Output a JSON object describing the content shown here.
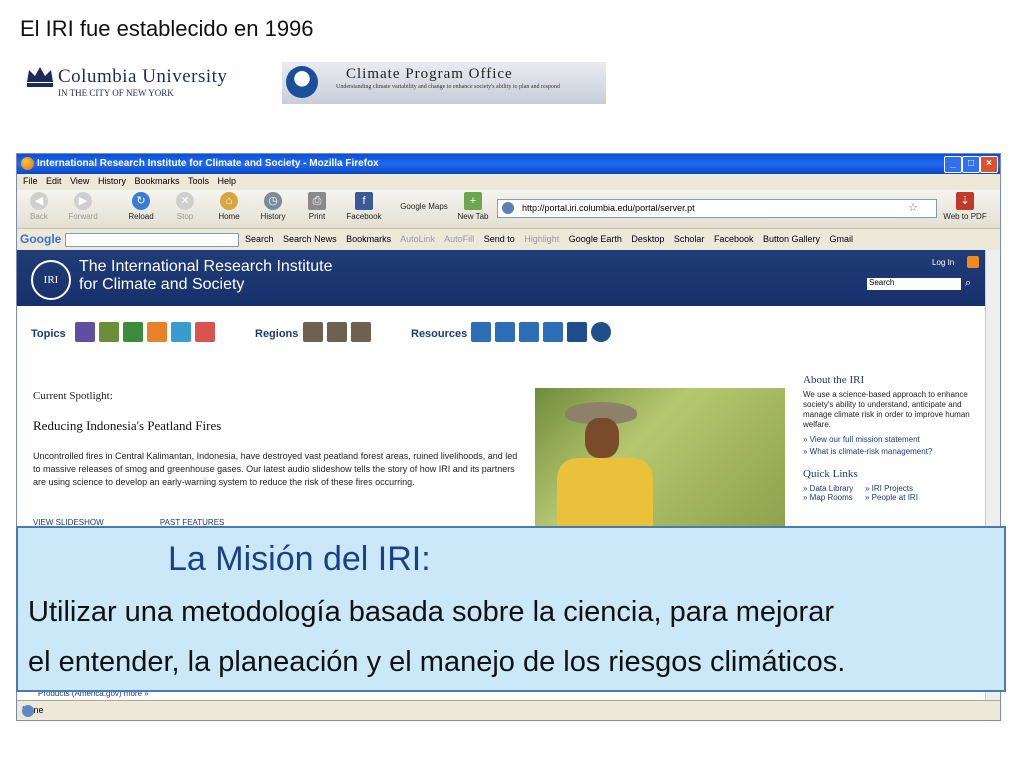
{
  "slide": {
    "title": "El IRI fue establecido en 1996",
    "columbia": {
      "name": "Columbia University",
      "sub": "IN THE CITY OF NEW YORK"
    },
    "cpo": {
      "title": "Climate Program Office",
      "sub": "Understanding climate variability and change to enhance society's ability to plan and respond"
    }
  },
  "browser": {
    "window_title": "International Research Institute for Climate and Society - Mozilla Firefox",
    "menu": [
      "File",
      "Edit",
      "View",
      "History",
      "Bookmarks",
      "Tools",
      "Help"
    ],
    "nav": {
      "back": "Back",
      "forward": "Forward",
      "reload": "Reload",
      "stop": "Stop",
      "home": "Home",
      "history": "History",
      "print": "Print",
      "facebook": "Facebook",
      "google_maps": "Google Maps",
      "new_tab": "New Tab",
      "web_to_pdf": "Web to PDF"
    },
    "url": "http://portal.iri.columbia.edu/portal/server.pt",
    "google_logo": "Google",
    "google_items": [
      "Search",
      "Search News",
      "Bookmarks",
      "AutoLink",
      "AutoFill",
      "Send to",
      "Highlight",
      "Google Earth",
      "Desktop",
      "Scholar",
      "Facebook",
      "Button Gallery",
      "Gmail"
    ],
    "status": "Done"
  },
  "site": {
    "logo": "IRI",
    "title_line1": "The International Research Institute",
    "title_line2": "for Climate and Society",
    "login": "Log In",
    "search_placeholder": "Search",
    "topics": "Topics",
    "regions": "Regions",
    "resources": "Resources",
    "spotlight_label": "Current Spotlight:",
    "spotlight_title": "Reducing Indonesia's Peatland Fires",
    "spotlight_body": "Uncontrolled fires in Central Kalimantan, Indonesia, have destroyed vast peatland forest areas, ruined livelihoods, and led to massive releases of smog and greenhouse gases. Our latest audio slideshow tells the story of how IRI and its partners are using science to develop an early-warning system to reduce the risk of these fires occurring.",
    "view_slideshow": "VIEW SLIDESHOW",
    "past_features": "PAST FEATURES",
    "about_heading": "About the IRI",
    "about_text": "We use a science-based approach to enhance society's ability to understand, anticipate and manage climate risk in order to improve human welfare.",
    "about_link1": "» View our full mission statement",
    "about_link2": "» What is climate-risk management?",
    "quick_heading": "Quick Links",
    "quick_links": [
      "» Data Library",
      "» IRI Projects",
      "» Map Rooms",
      "» People at IRI"
    ],
    "products_text": "Products (America.gov)  more »"
  },
  "mission": {
    "title": "La Misión del IRI:",
    "line1": "Utilizar una metodología basada sobre la ciencia, para mejorar",
    "line2": "el entender, la planeación y el manejo de los riesgos climáticos."
  }
}
